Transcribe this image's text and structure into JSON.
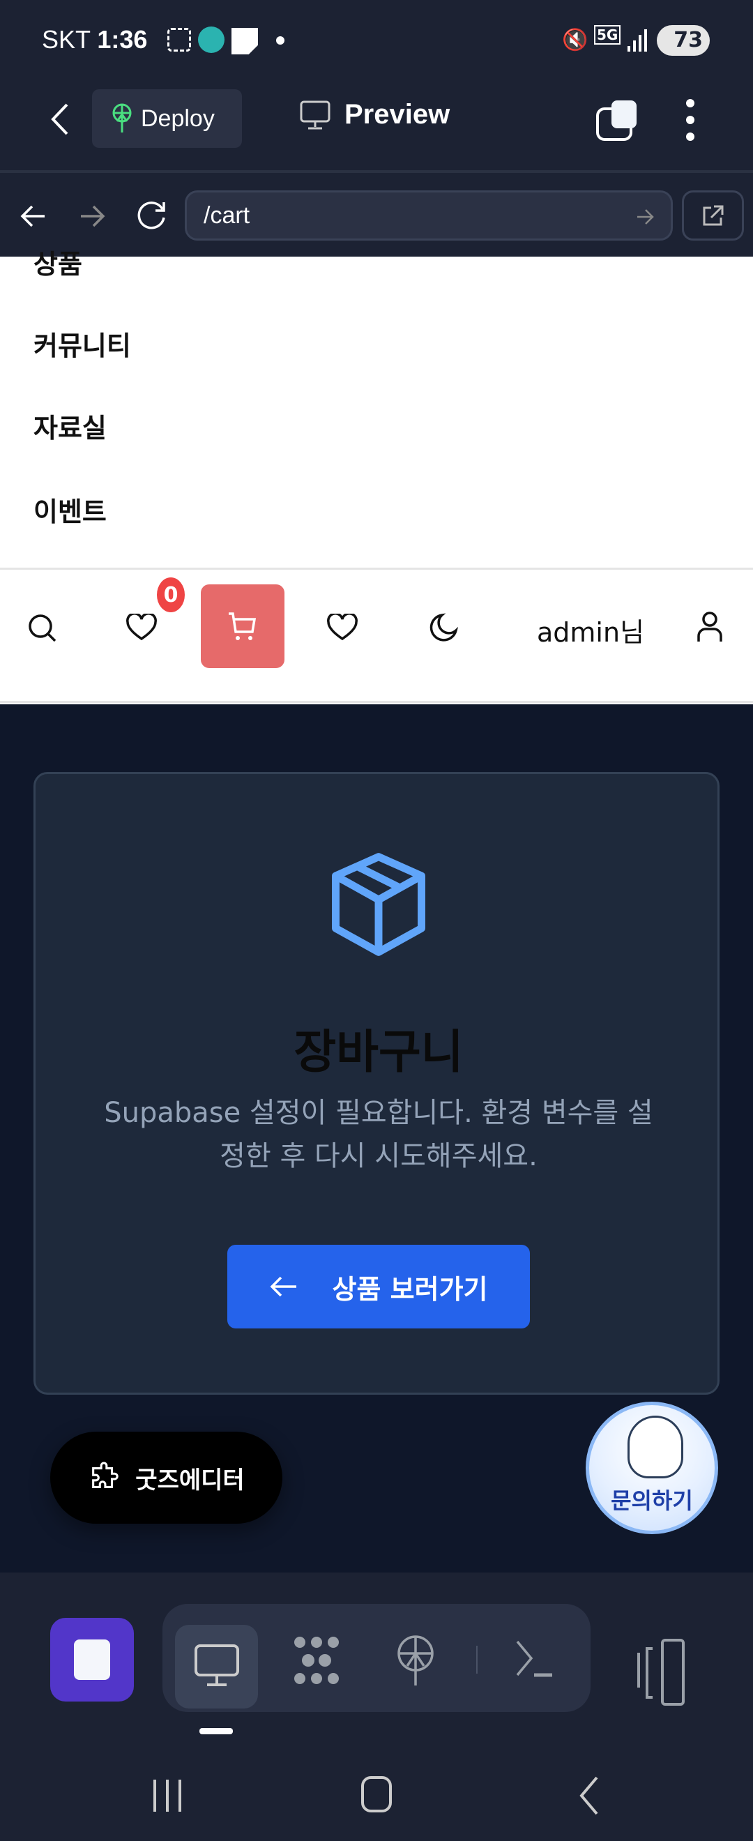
{
  "status_bar": {
    "carrier": "SKT",
    "time": "1:36",
    "battery": "73",
    "network": "5G"
  },
  "app_header": {
    "deploy_label": "Deploy",
    "preview_label": "Preview"
  },
  "browser": {
    "url": "/cart"
  },
  "site_menu": {
    "items": [
      "상품",
      "커뮤니티",
      "자료실",
      "이벤트"
    ]
  },
  "site_icons": {
    "wishlist_badge": "0",
    "user_label": "admin님"
  },
  "cart": {
    "title": "장바구니",
    "message": "Supabase 설정이 필요합니다. 환경 변수를 설정한 후 다시 시도해주세요.",
    "button_label": "상품 보러가기",
    "icon_color": "#60a5fa",
    "button_color": "#2563eb"
  },
  "floating": {
    "goods_editor_label": "굿즈에디터",
    "inquiry_label": "문의하기"
  },
  "colors": {
    "cart_button": "#e66a6a",
    "stop_button": "#5236c9",
    "deploy_icon": "#4ade80"
  }
}
